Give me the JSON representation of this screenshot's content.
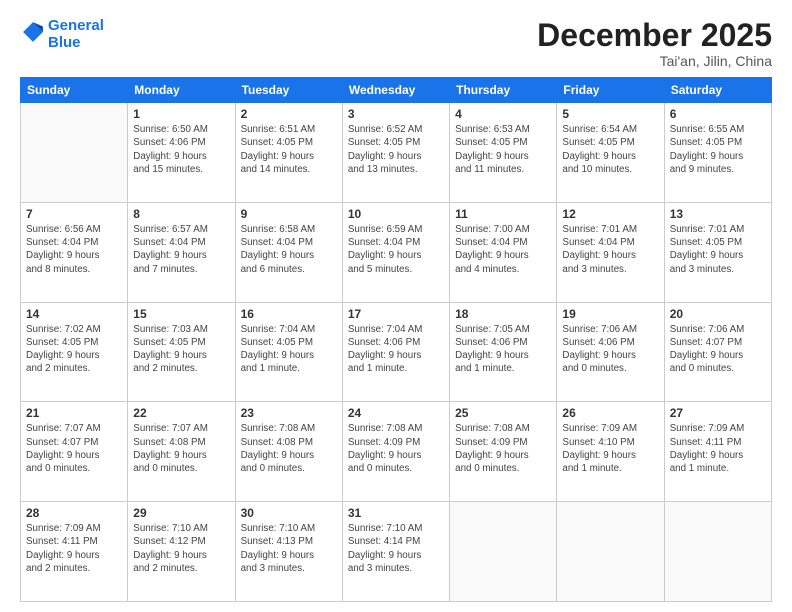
{
  "logo": {
    "line1": "General",
    "line2": "Blue"
  },
  "title": "December 2025",
  "subtitle": "Tai'an, Jilin, China",
  "weekdays": [
    "Sunday",
    "Monday",
    "Tuesday",
    "Wednesday",
    "Thursday",
    "Friday",
    "Saturday"
  ],
  "weeks": [
    [
      {
        "day": "",
        "info": ""
      },
      {
        "day": "1",
        "info": "Sunrise: 6:50 AM\nSunset: 4:06 PM\nDaylight: 9 hours\nand 15 minutes."
      },
      {
        "day": "2",
        "info": "Sunrise: 6:51 AM\nSunset: 4:05 PM\nDaylight: 9 hours\nand 14 minutes."
      },
      {
        "day": "3",
        "info": "Sunrise: 6:52 AM\nSunset: 4:05 PM\nDaylight: 9 hours\nand 13 minutes."
      },
      {
        "day": "4",
        "info": "Sunrise: 6:53 AM\nSunset: 4:05 PM\nDaylight: 9 hours\nand 11 minutes."
      },
      {
        "day": "5",
        "info": "Sunrise: 6:54 AM\nSunset: 4:05 PM\nDaylight: 9 hours\nand 10 minutes."
      },
      {
        "day": "6",
        "info": "Sunrise: 6:55 AM\nSunset: 4:05 PM\nDaylight: 9 hours\nand 9 minutes."
      }
    ],
    [
      {
        "day": "7",
        "info": "Sunrise: 6:56 AM\nSunset: 4:04 PM\nDaylight: 9 hours\nand 8 minutes."
      },
      {
        "day": "8",
        "info": "Sunrise: 6:57 AM\nSunset: 4:04 PM\nDaylight: 9 hours\nand 7 minutes."
      },
      {
        "day": "9",
        "info": "Sunrise: 6:58 AM\nSunset: 4:04 PM\nDaylight: 9 hours\nand 6 minutes."
      },
      {
        "day": "10",
        "info": "Sunrise: 6:59 AM\nSunset: 4:04 PM\nDaylight: 9 hours\nand 5 minutes."
      },
      {
        "day": "11",
        "info": "Sunrise: 7:00 AM\nSunset: 4:04 PM\nDaylight: 9 hours\nand 4 minutes."
      },
      {
        "day": "12",
        "info": "Sunrise: 7:01 AM\nSunset: 4:04 PM\nDaylight: 9 hours\nand 3 minutes."
      },
      {
        "day": "13",
        "info": "Sunrise: 7:01 AM\nSunset: 4:05 PM\nDaylight: 9 hours\nand 3 minutes."
      }
    ],
    [
      {
        "day": "14",
        "info": "Sunrise: 7:02 AM\nSunset: 4:05 PM\nDaylight: 9 hours\nand 2 minutes."
      },
      {
        "day": "15",
        "info": "Sunrise: 7:03 AM\nSunset: 4:05 PM\nDaylight: 9 hours\nand 2 minutes."
      },
      {
        "day": "16",
        "info": "Sunrise: 7:04 AM\nSunset: 4:05 PM\nDaylight: 9 hours\nand 1 minute."
      },
      {
        "day": "17",
        "info": "Sunrise: 7:04 AM\nSunset: 4:06 PM\nDaylight: 9 hours\nand 1 minute."
      },
      {
        "day": "18",
        "info": "Sunrise: 7:05 AM\nSunset: 4:06 PM\nDaylight: 9 hours\nand 1 minute."
      },
      {
        "day": "19",
        "info": "Sunrise: 7:06 AM\nSunset: 4:06 PM\nDaylight: 9 hours\nand 0 minutes."
      },
      {
        "day": "20",
        "info": "Sunrise: 7:06 AM\nSunset: 4:07 PM\nDaylight: 9 hours\nand 0 minutes."
      }
    ],
    [
      {
        "day": "21",
        "info": "Sunrise: 7:07 AM\nSunset: 4:07 PM\nDaylight: 9 hours\nand 0 minutes."
      },
      {
        "day": "22",
        "info": "Sunrise: 7:07 AM\nSunset: 4:08 PM\nDaylight: 9 hours\nand 0 minutes."
      },
      {
        "day": "23",
        "info": "Sunrise: 7:08 AM\nSunset: 4:08 PM\nDaylight: 9 hours\nand 0 minutes."
      },
      {
        "day": "24",
        "info": "Sunrise: 7:08 AM\nSunset: 4:09 PM\nDaylight: 9 hours\nand 0 minutes."
      },
      {
        "day": "25",
        "info": "Sunrise: 7:08 AM\nSunset: 4:09 PM\nDaylight: 9 hours\nand 0 minutes."
      },
      {
        "day": "26",
        "info": "Sunrise: 7:09 AM\nSunset: 4:10 PM\nDaylight: 9 hours\nand 1 minute."
      },
      {
        "day": "27",
        "info": "Sunrise: 7:09 AM\nSunset: 4:11 PM\nDaylight: 9 hours\nand 1 minute."
      }
    ],
    [
      {
        "day": "28",
        "info": "Sunrise: 7:09 AM\nSunset: 4:11 PM\nDaylight: 9 hours\nand 2 minutes."
      },
      {
        "day": "29",
        "info": "Sunrise: 7:10 AM\nSunset: 4:12 PM\nDaylight: 9 hours\nand 2 minutes."
      },
      {
        "day": "30",
        "info": "Sunrise: 7:10 AM\nSunset: 4:13 PM\nDaylight: 9 hours\nand 3 minutes."
      },
      {
        "day": "31",
        "info": "Sunrise: 7:10 AM\nSunset: 4:14 PM\nDaylight: 9 hours\nand 3 minutes."
      },
      {
        "day": "",
        "info": ""
      },
      {
        "day": "",
        "info": ""
      },
      {
        "day": "",
        "info": ""
      }
    ]
  ]
}
